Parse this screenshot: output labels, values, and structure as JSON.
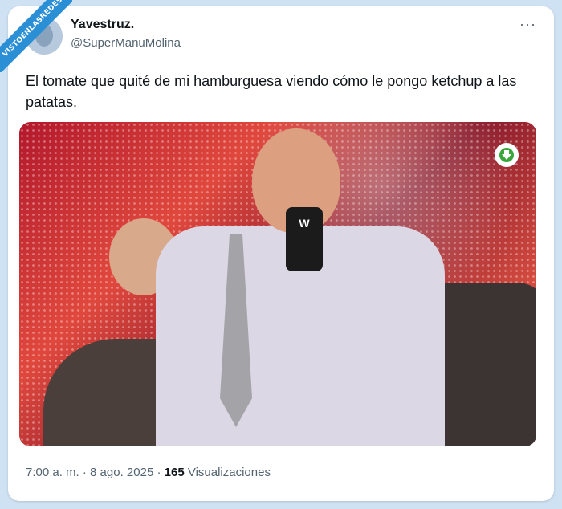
{
  "ribbon": {
    "text": "VISTOENLASREDES"
  },
  "tweet": {
    "display_name": "Yavestruz.",
    "handle": "@SuperManuMolina",
    "more_label": "···",
    "text": "El tomate que quité de mi hamburguesa viendo cómo le pongo ketchup a las patatas."
  },
  "media": {
    "mic_logo": "W",
    "download_icon": "download-arrow-icon"
  },
  "meta": {
    "time": "7:00 a. m.",
    "sep1": " · ",
    "date": "8 ago. 2025",
    "sep2": " · ",
    "views_count": "165",
    "views_label": " Visualizaciones"
  },
  "colors": {
    "background": "#cfe2f3",
    "ribbon": "#2b8fd6",
    "download_icon": "#3aa53a",
    "secondary_text": "#536471"
  }
}
